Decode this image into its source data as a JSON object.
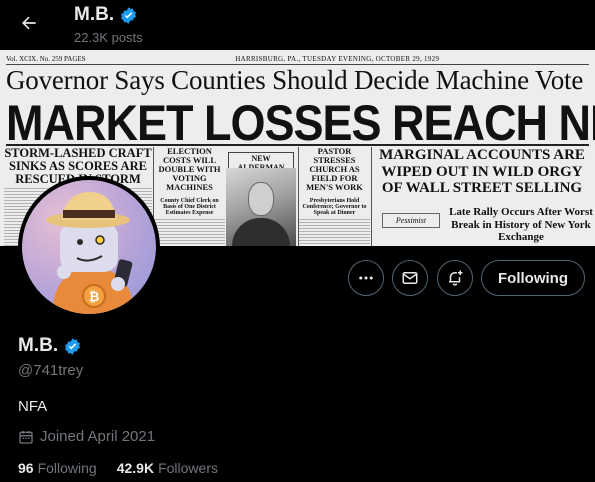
{
  "header": {
    "title": "M.B.",
    "posts_count": "22.3K posts"
  },
  "banner": {
    "dateline_left": "Vol. XCIX.   No. 259   PAGES",
    "dateline_center": "HARRISBURG, PA., TUESDAY EVENING, OCTOBER 29, 1929",
    "headline_top": "Governor Says Counties Should Decide Machine Vote",
    "headline_main": "MARKET LOSSES REACH NEW LEVEL",
    "col1_head": "STORM-LASHED CRAFT SINKS AS SCORES ARE RESCUED IN STORM",
    "col2_head": "ELECTION COSTS WILL DOUBLE WITH VOTING MACHINES",
    "col2_sub": "County Chief Clerk on Basis of One District Estimates Expense",
    "photo_caption": "NEW ALDERMAN",
    "col3_head": "PASTOR STRESSES CHURCH AS FIELD FOR MEN'S WORK",
    "col3_sub": "Presbyterians Hold Conference; Governor to Speak at Dinner",
    "right_head": "MARGINAL ACCOUNTS ARE WIPED OUT IN WILD ORGY OF WALL STREET SELLING",
    "box_label": "Pessimist",
    "rally_head": "Late Rally Occurs After Worst Break in History of New York Exchange"
  },
  "actions": {
    "following_label": "Following"
  },
  "profile": {
    "name": "M.B.",
    "handle": "@741trey",
    "bio": "NFA",
    "joined": "Joined April 2021",
    "following_count": "96",
    "following_label": "Following",
    "followers_count": "42.9K",
    "followers_label": "Followers"
  },
  "icons": {
    "back": "arrow-left-icon",
    "verified": "verified-badge-icon",
    "more": "more-icon",
    "message": "envelope-icon",
    "notify": "bell-plus-icon",
    "calendar": "calendar-icon"
  },
  "colors": {
    "background": "#000000",
    "text_primary": "#e7e9ea",
    "text_secondary": "#71767b",
    "verified": "#1d9bf0",
    "button_border": "#536471"
  }
}
